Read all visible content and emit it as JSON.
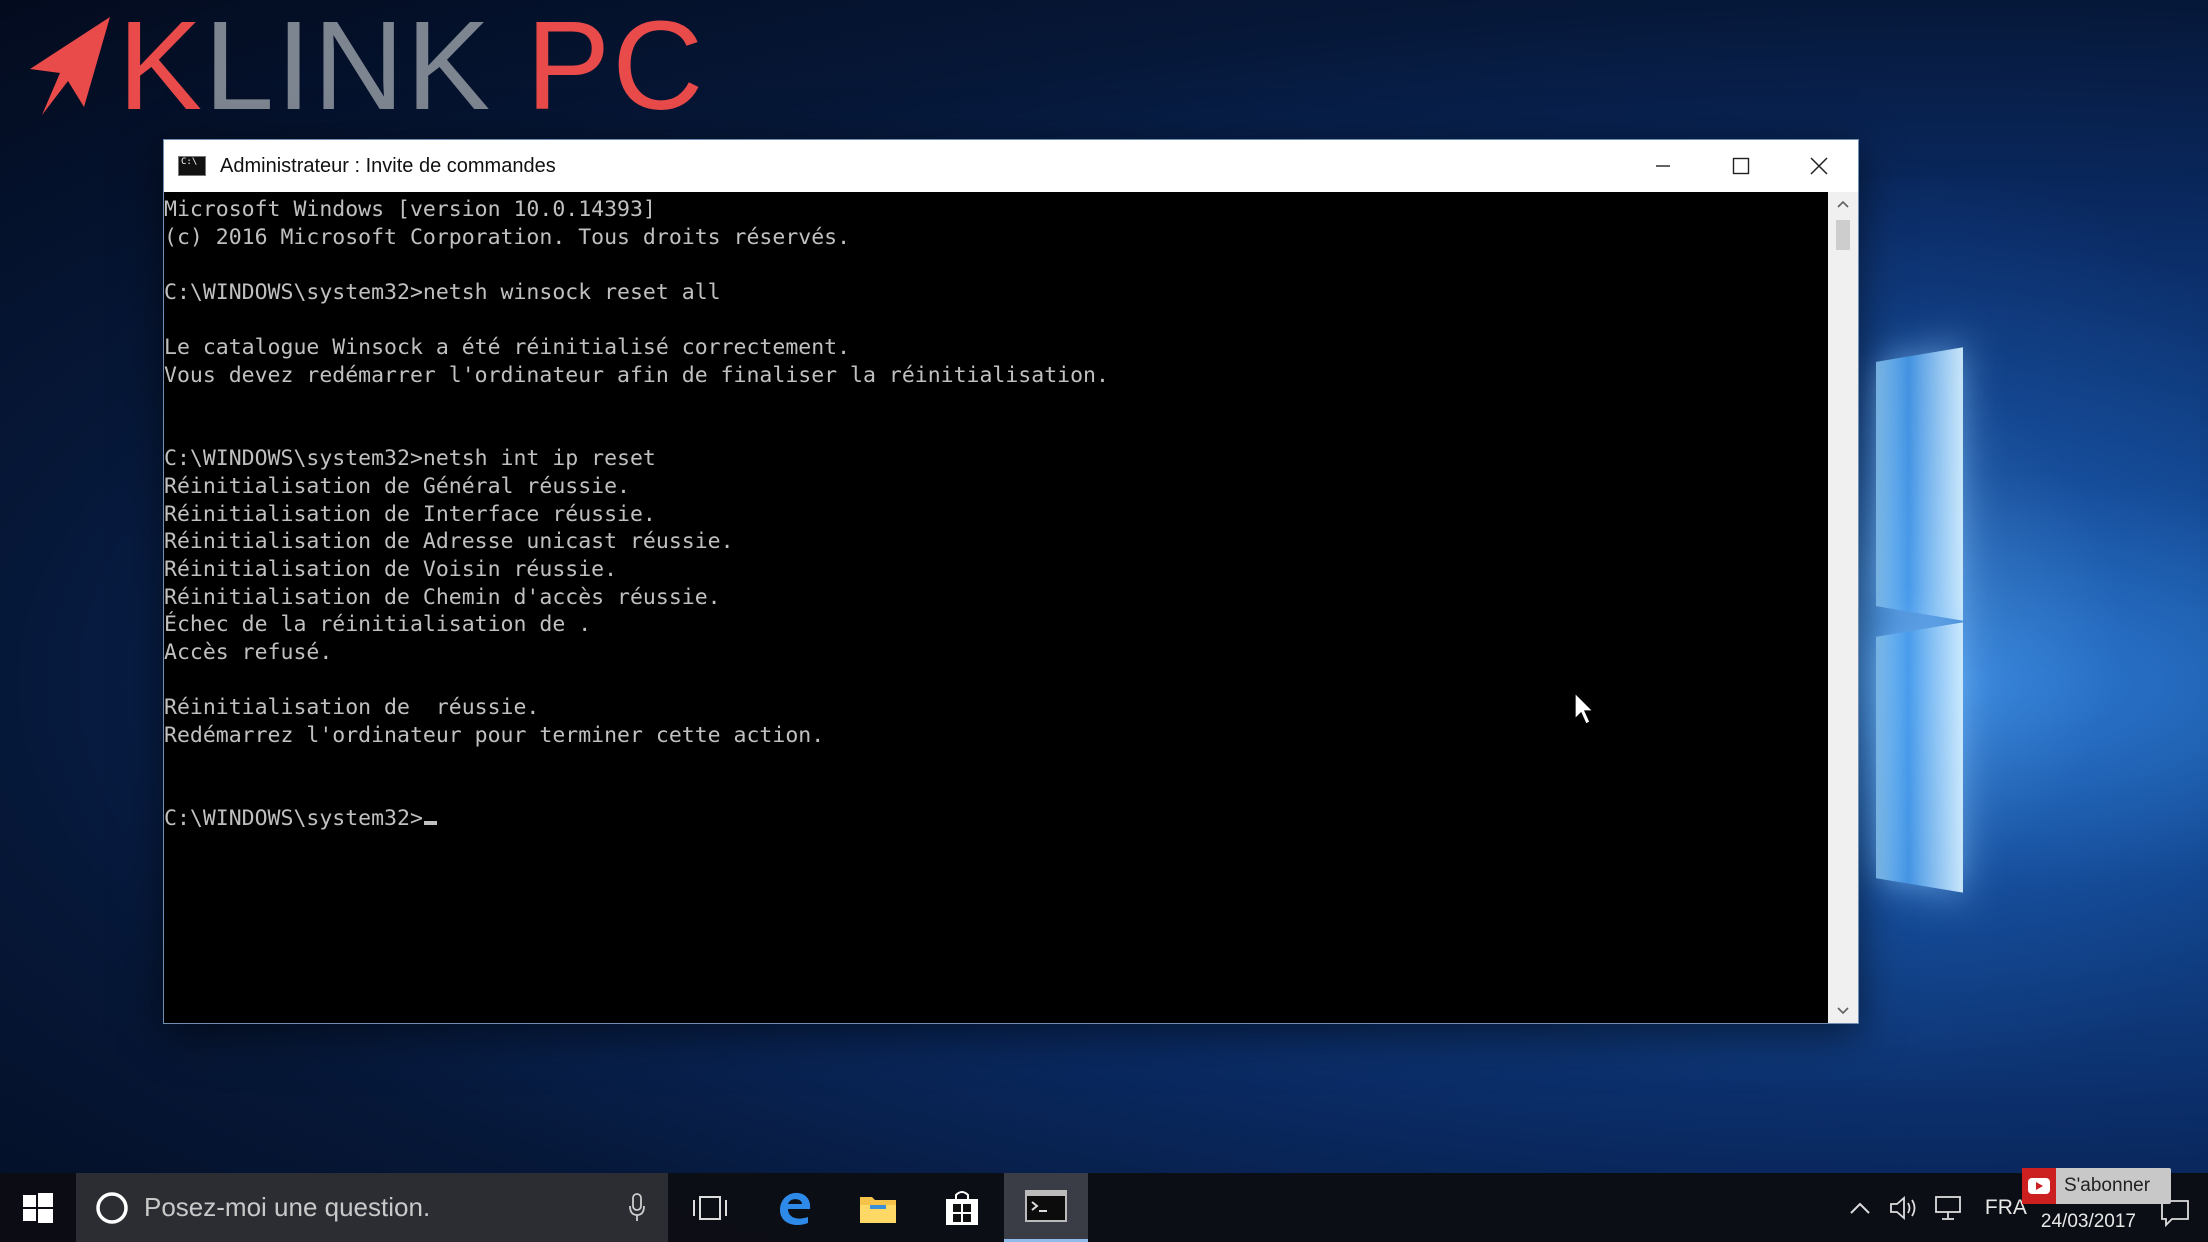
{
  "brand": {
    "prefix": "K",
    "middle": "LINK",
    "suffix": "PC"
  },
  "window": {
    "title": "Administrateur : Invite de commandes",
    "lines": [
      "Microsoft Windows [version 10.0.14393]",
      "(c) 2016 Microsoft Corporation. Tous droits réservés.",
      "",
      "C:\\WINDOWS\\system32>netsh winsock reset all",
      "",
      "Le catalogue Winsock a été réinitialisé correctement.",
      "Vous devez redémarrer l'ordinateur afin de finaliser la réinitialisation.",
      "",
      "",
      "C:\\WINDOWS\\system32>netsh int ip reset",
      "Réinitialisation de Général réussie.",
      "Réinitialisation de Interface réussie.",
      "Réinitialisation de Adresse unicast réussie.",
      "Réinitialisation de Voisin réussie.",
      "Réinitialisation de Chemin d'accès réussie.",
      "Échec de la réinitialisation de .",
      "Accès refusé.",
      "",
      "Réinitialisation de  réussie.",
      "Redémarrez l'ordinateur pour terminer cette action.",
      "",
      "",
      "C:\\WINDOWS\\system32>"
    ]
  },
  "taskbar": {
    "search_placeholder": "Posez-moi une question.",
    "language": "FRA",
    "date": "24/03/2017"
  },
  "subscribe": {
    "label": "S'abonner"
  },
  "icons": {
    "start": "windows-logo-icon",
    "cortana": "cortana-circle-icon",
    "mic": "microphone-icon",
    "task_view": "task-view-icon",
    "edge": "edge-browser-icon",
    "explorer": "file-explorer-icon",
    "store": "store-icon",
    "cmd": "command-prompt-icon"
  }
}
